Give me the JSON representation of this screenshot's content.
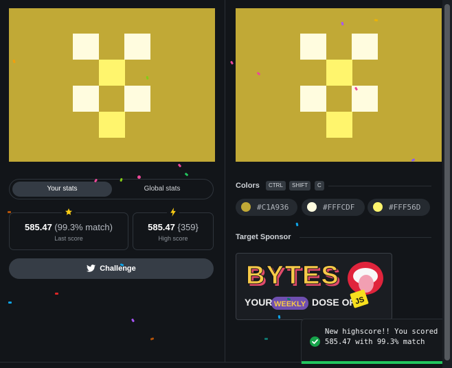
{
  "colors": {
    "target": "#C1A936",
    "cream": "#FFFCDF",
    "yellow": "#FFF56D",
    "accent_green": "#22C55E"
  },
  "stats_tabs": {
    "your_stats": "Your stats",
    "global_stats": "Global stats"
  },
  "last_score": {
    "score": "585.47",
    "detail": "(99.3% match)",
    "caption": "Last score",
    "icon": "star-icon"
  },
  "high_score": {
    "score": "585.47",
    "detail": "{359}",
    "caption": "High score",
    "icon": "lightning-icon"
  },
  "challenge_button": {
    "label": "Challenge",
    "icon": "twitter-icon"
  },
  "colors_section": {
    "title": "Colors",
    "shortcuts": [
      "CTRL",
      "SHIFT",
      "C"
    ],
    "swatches": [
      {
        "hex": "#C1A936"
      },
      {
        "hex": "#FFFCDF"
      },
      {
        "hex": "#FFF56D"
      }
    ]
  },
  "sponsor_section": {
    "title": "Target Sponsor",
    "logo_text": "BYTES",
    "tagline_prefix": "YOUR",
    "tagline_highlight": "WEEKLY",
    "tagline_suffix": "DOSE OF",
    "badge": "JS"
  },
  "toast": {
    "message": "New highscore!! You scored 585.47 with 99.3% match",
    "icon": "check-circle-icon",
    "progress": 0.97
  }
}
